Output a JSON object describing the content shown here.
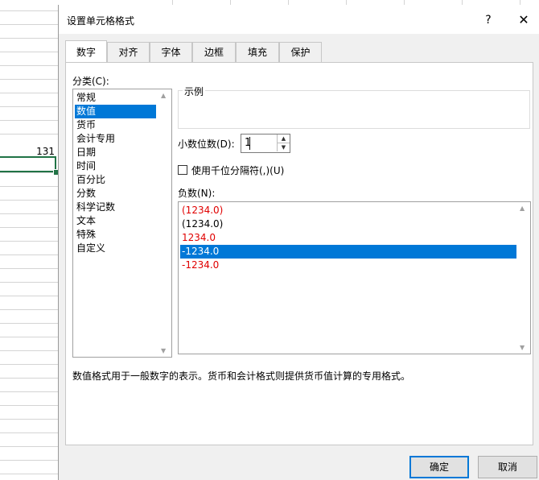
{
  "sheet": {
    "cell_value": "131"
  },
  "dialog": {
    "title": "设置单元格格式",
    "help": "?",
    "close": "✕",
    "tabs": [
      "数字",
      "对齐",
      "字体",
      "边框",
      "填充",
      "保护"
    ],
    "category_label": "分类(C):",
    "categories": [
      "常规",
      "数值",
      "货币",
      "会计专用",
      "日期",
      "时间",
      "百分比",
      "分数",
      "科学记数",
      "文本",
      "特殊",
      "自定义"
    ],
    "selected_category": "数值",
    "sample_label": "示例",
    "decimal_label": "小数位数(D):",
    "decimal_value": "1",
    "thousands_label": "使用千位分隔符(,)(U)",
    "thousands_checked": false,
    "negative_label": "负数(N):",
    "negative_options": [
      {
        "text": "(1234.0)",
        "color": "#e00000"
      },
      {
        "text": "(1234.0)",
        "color": "#000000"
      },
      {
        "text": "1234.0",
        "color": "#e00000"
      },
      {
        "text": "-1234.0",
        "color": "#000000",
        "selected": true
      },
      {
        "text": "-1234.0",
        "color": "#e00000"
      }
    ],
    "description": "数值格式用于一般数字的表示。货币和会计格式则提供货币值计算的专用格式。",
    "ok_label": "确定",
    "cancel_label": "取消"
  },
  "colors": {
    "accent": "#0078d7",
    "negative_red": "#e00000",
    "excel_green": "#217346"
  }
}
